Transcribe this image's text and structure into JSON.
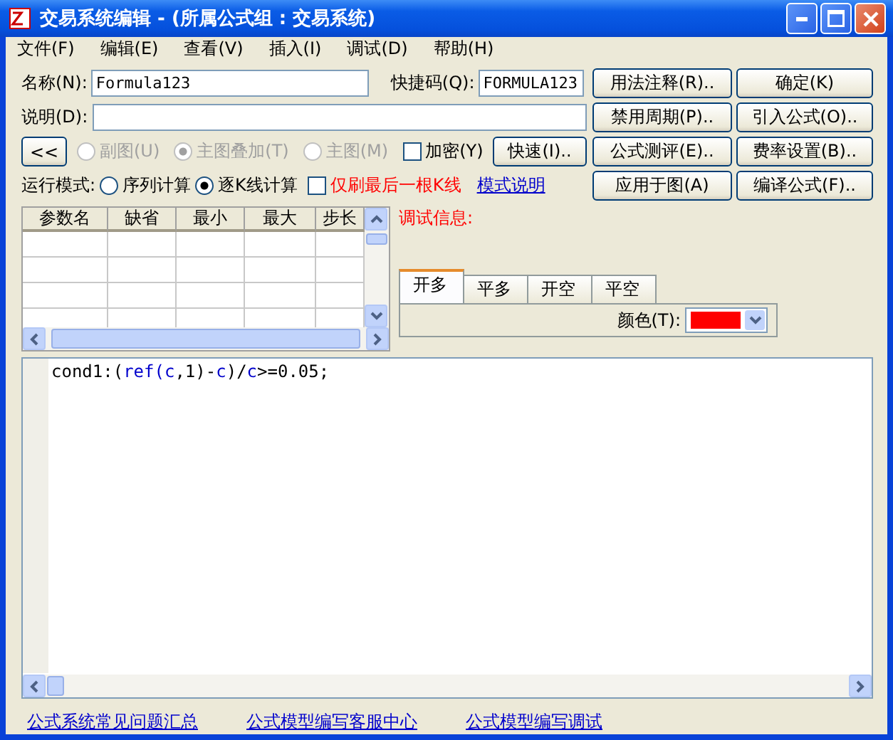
{
  "window": {
    "title": "交易系统编辑 - (所属公式组 : 交易系统)"
  },
  "menu": [
    "文件(F)",
    "编辑(E)",
    "查看(V)",
    "插入(I)",
    "调试(D)",
    "帮助(H)"
  ],
  "name_field": {
    "label": "名称(N):",
    "value": "Formula123"
  },
  "shortcut_field": {
    "label": "快捷码(Q):",
    "value": "FORMULA123"
  },
  "description_field": {
    "label": "说明(D):"
  },
  "collapse_button": "<<",
  "chart_types": [
    {
      "label": "副图(U)",
      "selected": false,
      "disabled": true
    },
    {
      "label": "主图叠加(T)",
      "selected": true,
      "disabled": true
    },
    {
      "label": "主图(M)",
      "selected": false,
      "disabled": true
    }
  ],
  "encrypt": {
    "label": "加密(Y)",
    "checked": false
  },
  "quick_button": "快速(I)..",
  "run_mode": {
    "label": "运行模式:",
    "options": [
      {
        "label": "序列计算",
        "selected": false
      },
      {
        "label": "逐K线计算",
        "selected": true
      }
    ]
  },
  "refresh_last": {
    "label": "仅刷最后一根K线",
    "checked": false
  },
  "mode_link": "模式说明",
  "buttons": [
    [
      "用法注释(R)..",
      "确定(K)"
    ],
    [
      "禁用周期(P)..",
      "引入公式(O).."
    ],
    [
      "公式测评(E)..",
      "费率设置(B).."
    ],
    [
      "应用于图(A)",
      "编译公式(F).."
    ]
  ],
  "param_table": {
    "columns": [
      "参数名",
      "缺省",
      "最小",
      "最大",
      "步长"
    ]
  },
  "debug": {
    "label": "调试信息:"
  },
  "signal_tabs": [
    {
      "label": "开多",
      "selected": true
    },
    {
      "label": "平多",
      "selected": false
    },
    {
      "label": "开空",
      "selected": false
    },
    {
      "label": "平空",
      "selected": false
    }
  ],
  "color_field": {
    "label": "颜色(T):",
    "color": "#ff0000"
  },
  "code": [
    {
      "text": "cond1:(",
      "kind": "plain"
    },
    {
      "text": "ref(c",
      "kind": "keyword"
    },
    {
      "text": ",1)-",
      "kind": "plain"
    },
    {
      "text": "c",
      "kind": "keyword"
    },
    {
      "text": ")/",
      "kind": "plain"
    },
    {
      "text": "c",
      "kind": "keyword"
    },
    {
      "text": ">=0.05;",
      "kind": "plain"
    }
  ],
  "links": [
    "公式系统常见问题汇总",
    "公式模型编写客服中心",
    "公式模型编写调试"
  ]
}
